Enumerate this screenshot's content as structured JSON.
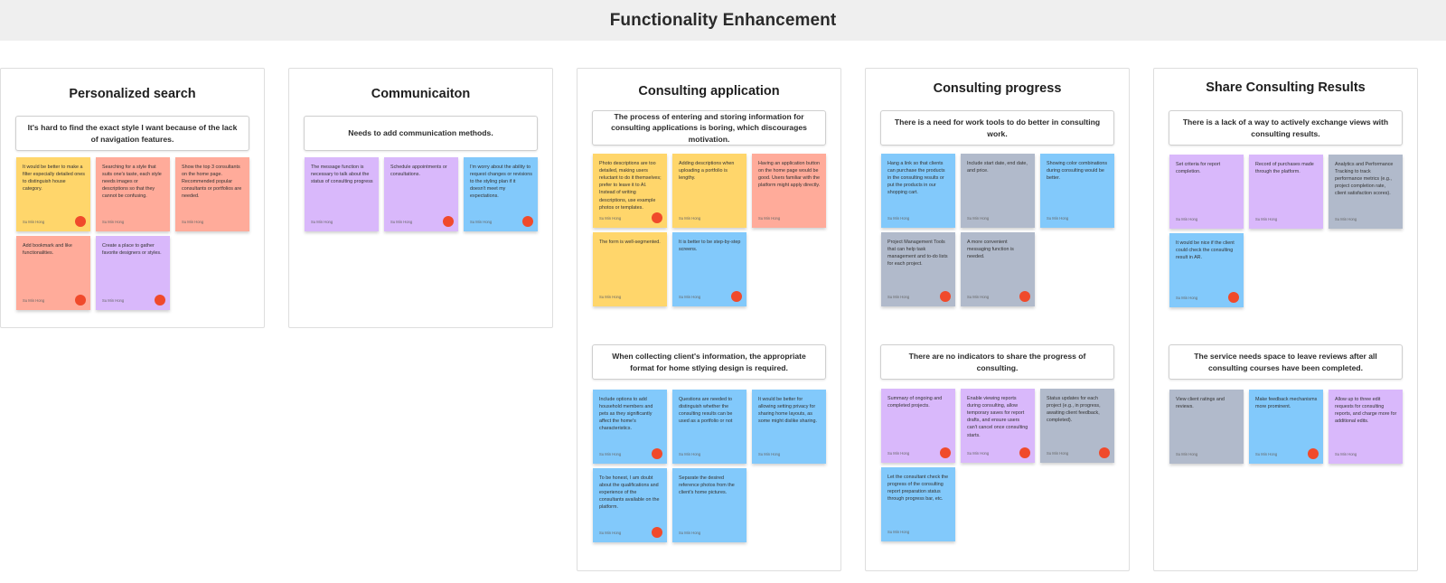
{
  "board": {
    "title": "Functionality Enhancement"
  },
  "colors": {
    "yellow": "#ffd66b",
    "salmon": "#ffab9a",
    "purple": "#d9b8fb",
    "blue": "#82c9fb",
    "gray": "#b1bacb",
    "vote_dot": "#f04a2b"
  },
  "author": "Su Min Hong",
  "sections": [
    {
      "title": "Personalized search",
      "groups": [
        {
          "problem": "It's hard to find the exact style I want because of the lack of navigation features.",
          "notes": [
            {
              "text": "It would be better to make a filter especially detailed ones to distinguish house category.",
              "color": "yellow",
              "voted": true
            },
            {
              "text": "Searching for a style that suits one's taste, each style needs images or descriptions so that they cannot be confusing.",
              "color": "salmon",
              "voted": false
            },
            {
              "text": "Show the top 3 consultants on the home page. Recommended popular consultants or portfolios are needed.",
              "color": "salmon",
              "voted": false
            },
            {
              "text": "Add bookmark and like functionalities.",
              "color": "salmon",
              "voted": true
            },
            {
              "text": "Create a place to gather favorite designers or styles.",
              "color": "purple",
              "voted": true
            }
          ]
        }
      ]
    },
    {
      "title": "Communicaiton",
      "groups": [
        {
          "problem": "Needs to add communication methods.",
          "notes": [
            {
              "text": "The message function is necessary to talk about the status of consulting progress",
              "color": "purple",
              "voted": false
            },
            {
              "text": "Schedule appointments or consultations.",
              "color": "purple",
              "voted": true
            },
            {
              "text": "I'm worry about the ability to request changes or revisions to the styling plan if it doesn't meet my expectations.",
              "color": "blue",
              "voted": true
            }
          ]
        }
      ]
    },
    {
      "title": "Consulting application",
      "groups": [
        {
          "problem": "The process of entering and storing information for consulting applications is boring, which discourages motivation.",
          "notes": [
            {
              "text": "Photo descriptions are too detailed, making users reluctant to do it themselves; prefer to leave it to AI. Instead of writing descriptions, use example photos or templates.",
              "color": "yellow",
              "voted": true
            },
            {
              "text": "Adding descriptions when uploading a portfolio is lengthy.",
              "color": "yellow",
              "voted": false
            },
            {
              "text": "Having an application button on the home page would be good. Users familiar with the platform might apply directly.",
              "color": "salmon",
              "voted": false
            },
            {
              "text": "The form is well-segmented.",
              "color": "yellow",
              "voted": false
            },
            {
              "text": "It is better to be step-by-step screens.",
              "color": "blue",
              "voted": true
            }
          ]
        },
        {
          "problem": "When collecting client's information, the appropriate format for home stlying design is required.",
          "notes": [
            {
              "text": "Include options to add household members and pets as they significantly affect the home's characteristics.",
              "color": "blue",
              "voted": true
            },
            {
              "text": "Questions are needed to distinguish whether the consulting results can be used as a portfolio or not",
              "color": "blue",
              "voted": false
            },
            {
              "text": "It would be better for allowing setting privacy for sharing home layouts, as some might dislike sharing.",
              "color": "blue",
              "voted": false
            },
            {
              "text": "To be honest, I am doubt about the qualifications and experience of the consultants available on the platform.",
              "color": "blue",
              "voted": true
            },
            {
              "text": "Separate the desired reference photos from the client's home pictures.",
              "color": "blue",
              "voted": false
            }
          ]
        }
      ]
    },
    {
      "title": "Consulting progress",
      "groups": [
        {
          "problem": "There is a need for work tools to do better in consulting work.",
          "notes": [
            {
              "text": "Hang a link so that clients can purchase the products in the consulting results or put the products in our shopping cart.",
              "color": "blue",
              "voted": false
            },
            {
              "text": "Include start date, end date, and price.",
              "color": "gray",
              "voted": false
            },
            {
              "text": "Showing color combinations during consulting would be better.",
              "color": "blue",
              "voted": false
            },
            {
              "text": "Project Management Tools that can help task management and to-do lists for each project.",
              "color": "gray",
              "voted": true
            },
            {
              "text": "A more convenient messaging function is needed.",
              "color": "gray",
              "voted": true
            }
          ]
        },
        {
          "problem": "There are no indicators to share the progress of consulting.",
          "notes": [
            {
              "text": "Summary of ongoing and completed projects.",
              "color": "purple",
              "voted": true
            },
            {
              "text": "Enable viewing reports during consulting, allow temporary saves for report drafts, and ensure users can't cancel once consulting starts.",
              "color": "purple",
              "voted": true
            },
            {
              "text": "Status updates for each project (e.g., in progress, awaiting client feedback, completed).",
              "color": "gray",
              "voted": true
            },
            {
              "text": "Let the consultant check the progress of the consulting report preparation status through progress bar, etc.",
              "color": "blue",
              "voted": false
            }
          ]
        }
      ]
    },
    {
      "title": "Share Consulting Results",
      "groups": [
        {
          "problem": "There is a lack of a way to actively exchange views with consulting results.",
          "notes": [
            {
              "text": "Set criteria for report completion.",
              "color": "purple",
              "voted": false
            },
            {
              "text": "Record of purchases made through the platform.",
              "color": "purple",
              "voted": false
            },
            {
              "text": "Analytics and Performance Tracking to track performance metrics (e.g., project completion rate, client satisfaction scores).",
              "color": "gray",
              "voted": false
            },
            {
              "text": "It would be nice if the client could check the consulting result in AR.",
              "color": "blue",
              "voted": true
            }
          ]
        },
        {
          "problem": "The service needs space to leave reviews after all consulting courses have been completed.",
          "notes": [
            {
              "text": "View client ratings and reviews.",
              "color": "gray",
              "voted": false
            },
            {
              "text": "Make feedback mechanisms more prominent.",
              "color": "blue",
              "voted": true
            },
            {
              "text": "Allow up to three edit requests for consulting reports, and charge more for additional edits.",
              "color": "purple",
              "voted": false
            }
          ]
        }
      ]
    }
  ]
}
